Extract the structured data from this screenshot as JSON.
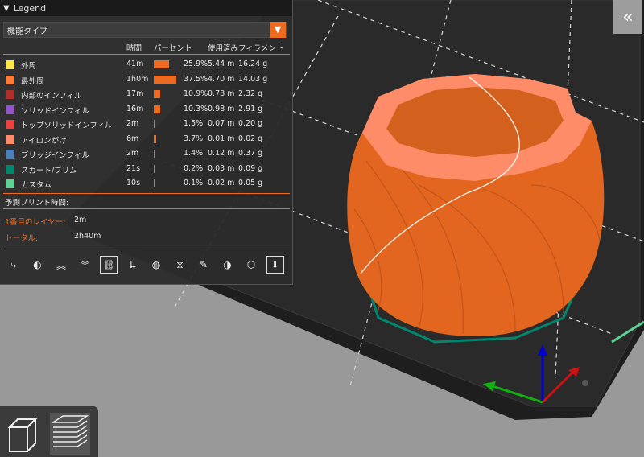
{
  "legend": {
    "title": "Legend",
    "view_type": "機能タイプ",
    "columns": [
      "時間",
      "パーセント",
      "使用済みフィラメント"
    ],
    "rows": [
      {
        "label": "外周",
        "color": "#ffe64d",
        "time": "41m",
        "percent": "25.9%",
        "percent_value": 25.9,
        "length": "5.44 m",
        "weight": "16.24 g"
      },
      {
        "label": "最外周",
        "color": "#ff7d38",
        "time": "1h0m",
        "percent": "37.5%",
        "percent_value": 37.5,
        "length": "4.70 m",
        "weight": "14.03 g"
      },
      {
        "label": "内部のインフィル",
        "color": "#b03029",
        "time": "17m",
        "percent": "10.9%",
        "percent_value": 10.9,
        "length": "0.78 m",
        "weight": "2.32 g"
      },
      {
        "label": "ソリッドインフィル",
        "color": "#9654cc",
        "time": "16m",
        "percent": "10.3%",
        "percent_value": 10.3,
        "length": "0.98 m",
        "weight": "2.91 g"
      },
      {
        "label": "トップソリッドインフィル",
        "color": "#f04040",
        "time": "2m",
        "percent": "1.5%",
        "percent_value": 1.5,
        "length": "0.07 m",
        "weight": "0.20 g"
      },
      {
        "label": "アイロンがけ",
        "color": "#ff8c69",
        "time": "6m",
        "percent": "3.7%",
        "percent_value": 3.7,
        "length": "0.01 m",
        "weight": "0.02 g"
      },
      {
        "label": "ブリッジインフィル",
        "color": "#4d80ba",
        "time": "2m",
        "percent": "1.4%",
        "percent_value": 1.4,
        "length": "0.12 m",
        "weight": "0.37 g"
      },
      {
        "label": "スカート/ブリム",
        "color": "#00876e",
        "time": "21s",
        "percent": "0.2%",
        "percent_value": 0.2,
        "length": "0.03 m",
        "weight": "0.09 g"
      },
      {
        "label": "カスタム",
        "color": "#5ed194",
        "time": "10s",
        "percent": "0.1%",
        "percent_value": 0.1,
        "length": "0.02 m",
        "weight": "0.05 g"
      }
    ],
    "estimate_title": "予測プリント時間:",
    "first_layer_label": "1番目のレイヤー:",
    "first_layer_value": "2m",
    "total_label": "トータル:",
    "total_value": "2h40m"
  },
  "toolbar_icons": [
    "travel-icon",
    "wipe-icon",
    "retractions-icon",
    "deretractions-icon",
    "seams-icon",
    "tool-changes-icon",
    "color-changes-icon",
    "pause-icon",
    "custom-gcode-icon",
    "center-of-gravity-icon",
    "shells-icon",
    "tool-marker-icon"
  ],
  "colors": {
    "accent": "#ed6b21",
    "model": "#e2661f",
    "bed": "#2c2c2c"
  }
}
